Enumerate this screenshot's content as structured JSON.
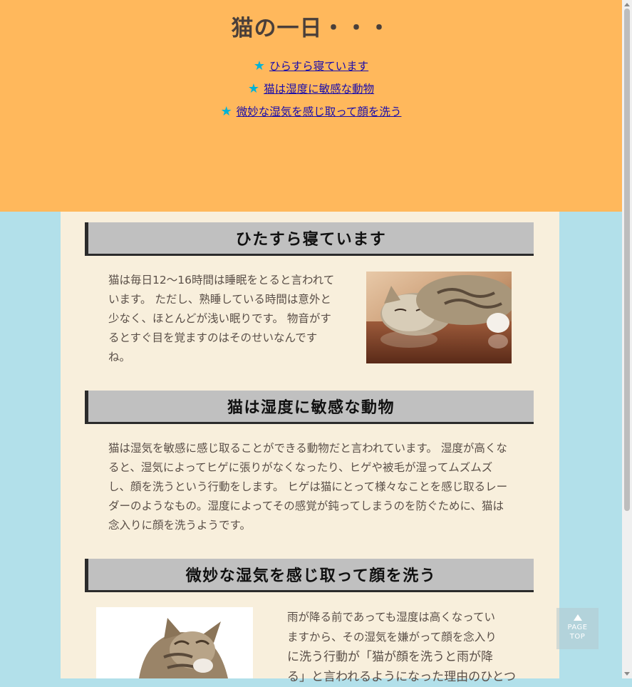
{
  "header": {
    "title": "猫の一日・・・",
    "toc": [
      {
        "icon": "star-icon",
        "label": "ひらすら寝ています"
      },
      {
        "icon": "star-icon",
        "label": "猫は湿度に敏感な動物"
      },
      {
        "icon": "star-icon",
        "label": "微妙な湿気を感じ取って顔を洗う"
      }
    ]
  },
  "sections": [
    {
      "heading": "ひたすら寝ています",
      "body": "猫は毎日12〜16時間は睡眠をとると言われています。 ただし、熟睡している時間は意外と少なく、ほとんどが浅い眠りです。 物音がするとすぐ目を覚ますのはそのせいなんですね。",
      "image": "sleeping-cat-photo"
    },
    {
      "heading": "猫は湿度に敏感な動物",
      "body": "猫は湿気を敏感に感じ取ることができる動物だと言われています。 湿度が高くなると、湿気によってヒゲに張りがなくなったり、ヒゲや被毛が湿ってムズムズし、顔を洗うという行動をします。 ヒゲは猫にとって様々なことを感じ取るレーダーのようなもの。湿度によってその感覚が鈍ってしまうのを防ぐために、猫は念入りに顔を洗うようです。"
    },
    {
      "heading": "微妙な湿気を感じ取って顔を洗う",
      "body_lines": [
        "雨が降る前であっても湿度は高くなってい",
        "ますから、その湿気を嫌がって顔を念入り",
        "に洗う行動が「猫が顔を洗うと雨が降",
        "る」と言われるようになった理由のひとつ"
      ],
      "image": "grooming-cat-photo"
    }
  ],
  "page_top": {
    "label": "PAGE\nTOP"
  },
  "colors": {
    "header_bg": "#ffb85c",
    "page_bg": "#b2e0ea",
    "content_bg": "#f8efdc",
    "star": "#00b2d6"
  }
}
